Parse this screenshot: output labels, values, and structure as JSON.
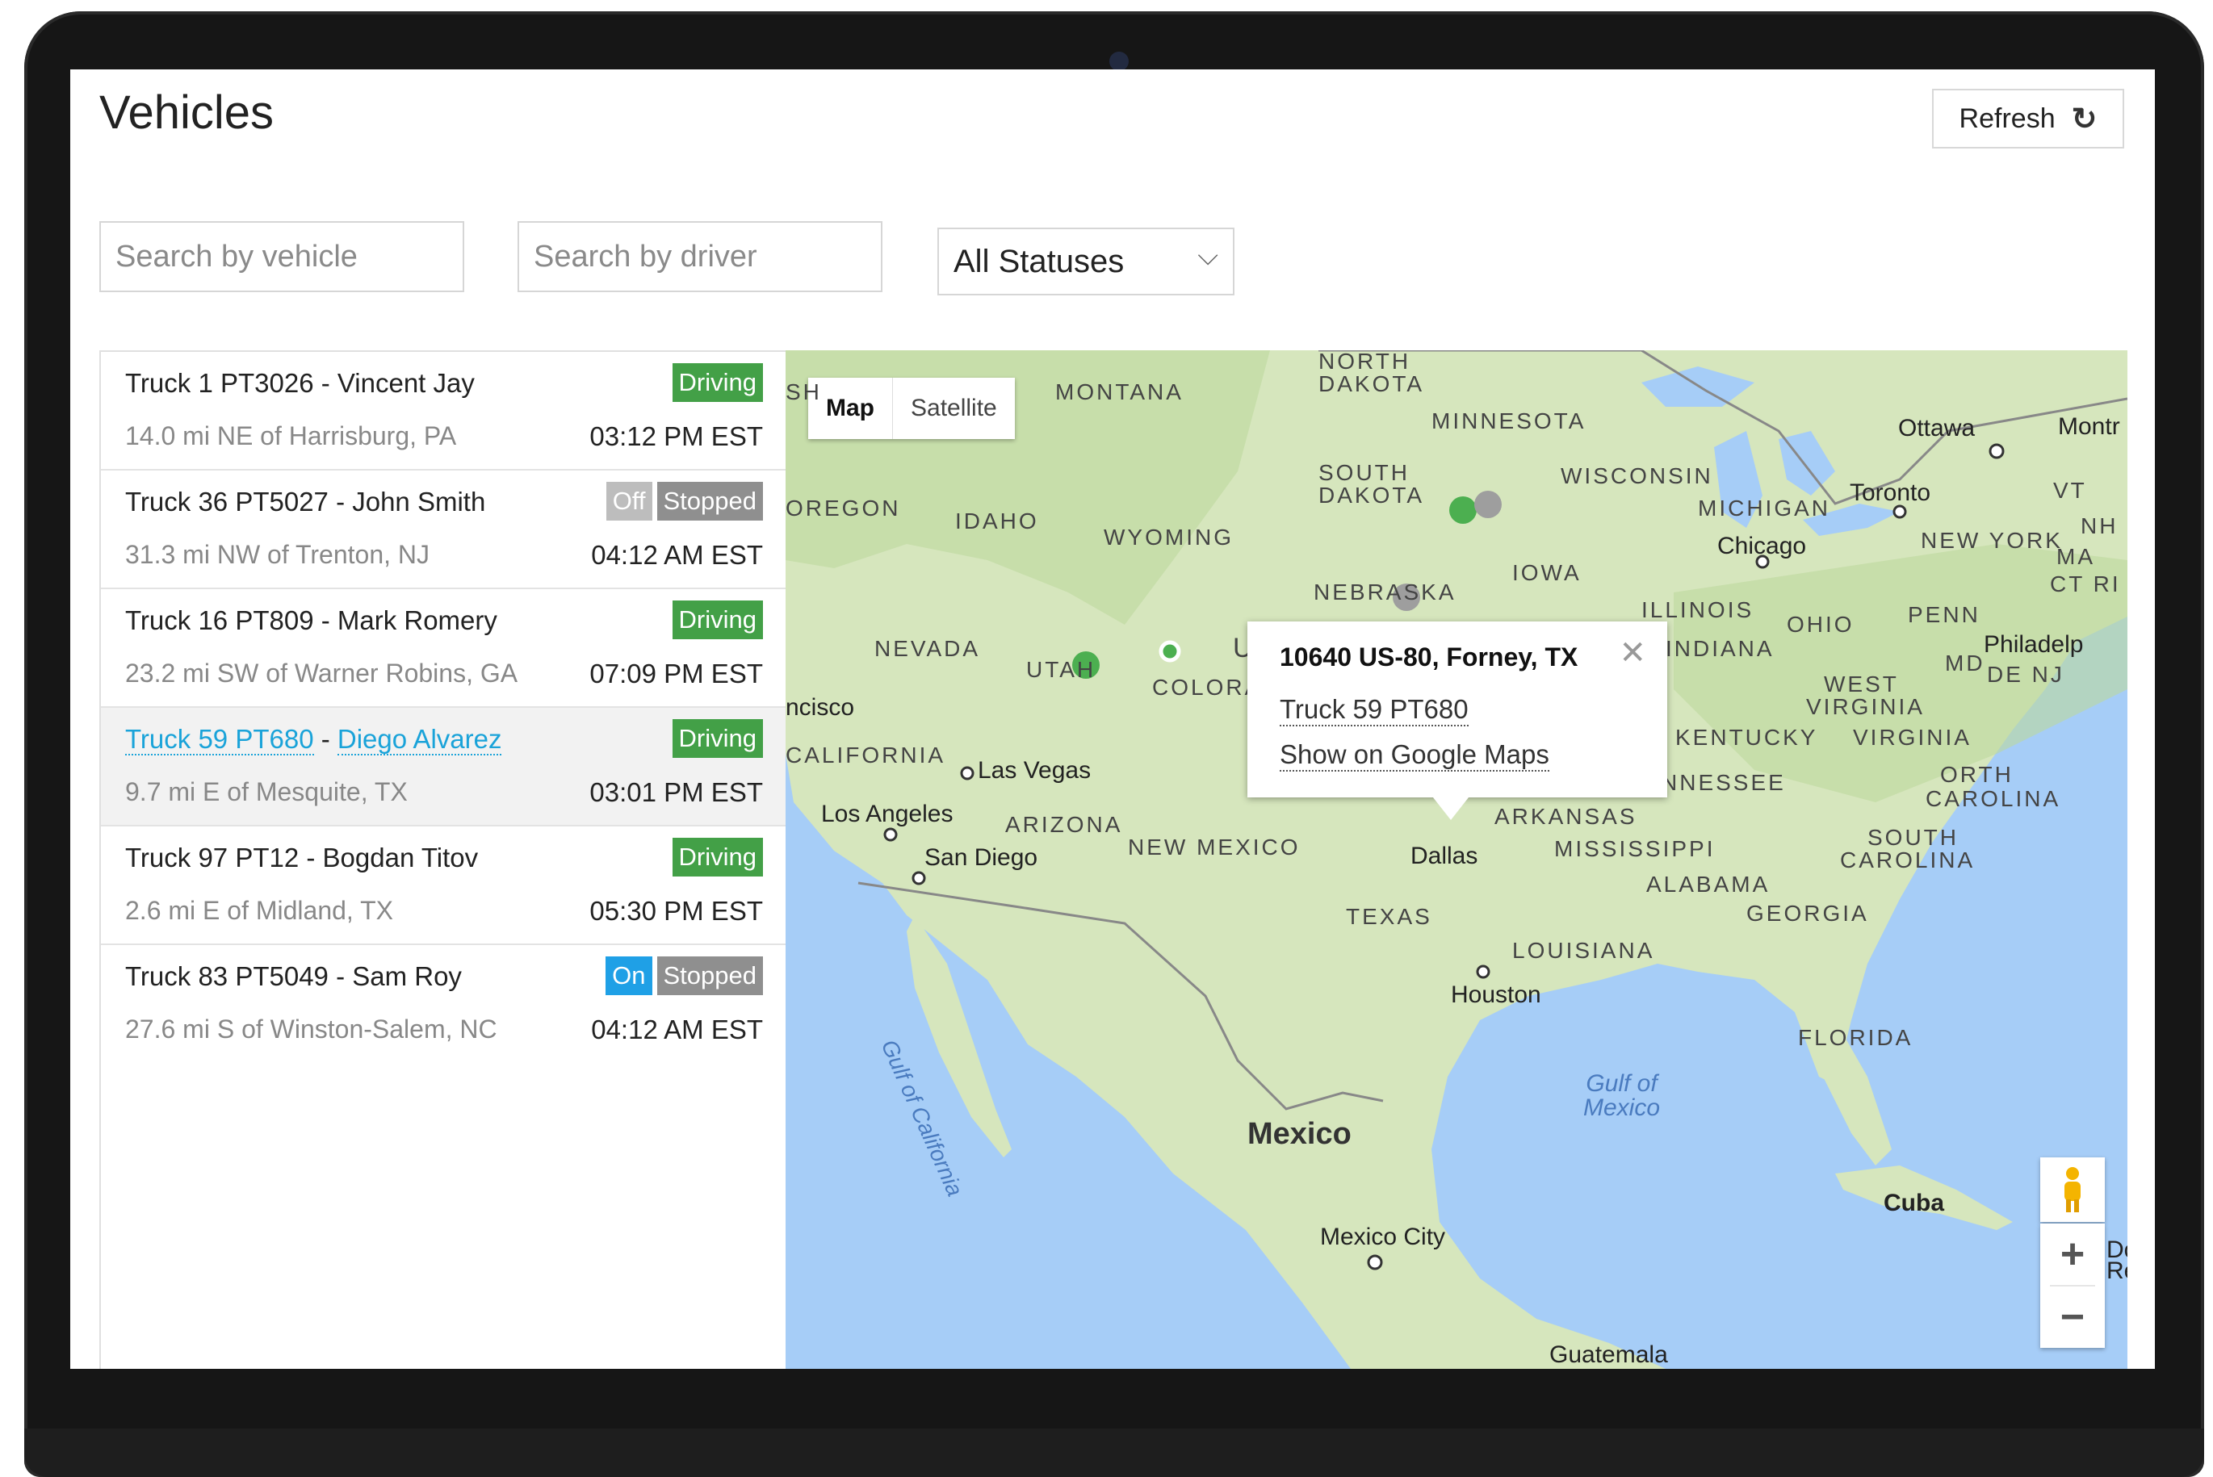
{
  "header": {
    "title": "Vehicles",
    "refresh_label": "Refresh",
    "refresh_icon": "↻"
  },
  "filters": {
    "vehicle_placeholder": "Search by vehicle",
    "driver_placeholder": "Search by driver",
    "status_value": "All Statuses",
    "chevron": "⌵"
  },
  "vehicles": [
    {
      "name": "Truck 1 PT3026 - Vincent Jay",
      "location": "14.0 mi NE of Harrisburg, PA",
      "time": "03:12 PM EST",
      "badge1": "Driving"
    },
    {
      "name": "Truck 36 PT5027 - John Smith",
      "location": "31.3 mi NW of Trenton, NJ",
      "time": "04:12 AM EST",
      "badge1": "Off",
      "badge2": "Stopped"
    },
    {
      "name": "Truck 16 PT809 - Mark Romery",
      "location": "23.2 mi SW of Warner Robins, GA",
      "time": "07:09 PM EST",
      "badge1": "Driving"
    },
    {
      "truck": "Truck 59 PT680",
      "sep": " - ",
      "driver": "Diego Alvarez",
      "location": "9.7 mi E of Mesquite, TX",
      "time": "03:01 PM EST",
      "badge1": "Driving"
    },
    {
      "name": "Truck 97 PT12 - Bogdan Titov",
      "location": "2.6 mi E of Midland, TX",
      "time": "05:30 PM EST",
      "badge1": "Driving"
    },
    {
      "name": "Truck 83 PT5049 - Sam Roy",
      "location": "27.6 mi S of Winston-Salem, NC",
      "time": "04:12 AM EST",
      "badge1": "On",
      "badge2": "Stopped"
    }
  ],
  "map": {
    "toggle_map": "Map",
    "toggle_satellite": "Satellite",
    "zoom_in": "+",
    "zoom_out": "−",
    "popup": {
      "title": "10640 US-80, Forney, TX",
      "close": "✕",
      "truck_link": "Truck 59 PT680",
      "maps_link": "Show on Google Maps"
    },
    "states": [
      "NORTH",
      "DAKOTA",
      "MONTANA",
      "MINNESOTA",
      "SOUTH",
      "DAKOTA",
      "WISCONSIN",
      "MICHIGAN",
      "OREGON",
      "IDAHO",
      "WYOMING",
      "IOWA",
      "NEBRASKA",
      "ILLINOIS",
      "OHIO",
      "PENN",
      "NEVADA",
      "UTAH",
      "COLORA",
      "INDIANA",
      "WEST",
      "VIRGINIA",
      "KENTUCKY",
      "VIRGINIA",
      "CALIFORNIA",
      "NNESSEE",
      "ORTH",
      "CAROLINA",
      "ARIZONA",
      "NEW MEXICO",
      "ARKANSAS",
      "MISSISSIPPI",
      "SOUTH",
      "CAROLINA",
      "ALABAMA",
      "GEORGIA",
      "TEXAS",
      "LOUISIANA",
      "FLORIDA",
      "NEW YORK",
      "VT",
      "NH",
      "MA",
      "CT RI",
      "MD",
      "DE NJ",
      "SH",
      "U"
    ],
    "cities": [
      "Ottawa",
      "Montr",
      "Toronto",
      "Chicago",
      "Philadelp",
      "Las Vegas",
      "ncisco",
      "Los Angeles",
      "San Diego",
      "Dallas",
      "Houston",
      "Mexico City",
      "Guatemala",
      "Cuba",
      "Dor",
      "Re"
    ],
    "water": [
      "Gulf of",
      "Mexico",
      "Gulf of California"
    ],
    "country": "Mexico",
    "colors": {
      "driving": "#4caf50",
      "stopped": "#9e9e9e",
      "land": "#cfe3b4",
      "water": "#a6cdf7"
    }
  }
}
